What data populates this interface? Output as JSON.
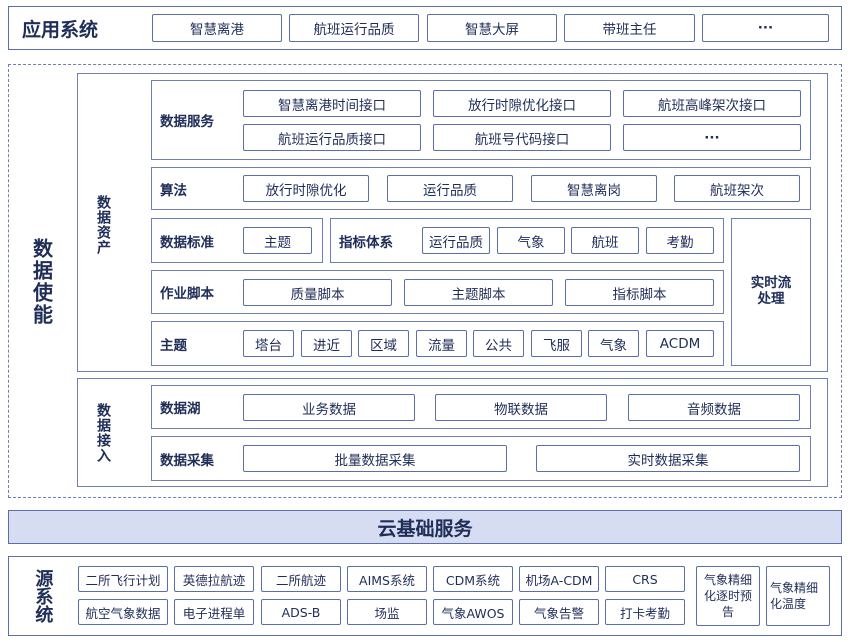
{
  "app_system": {
    "title": "应用系统",
    "items": [
      "智慧离港",
      "航班运行品质",
      "智慧大屏",
      "带班主任",
      "···"
    ]
  },
  "data_enable": {
    "title": "数据使能",
    "assets_title": "数据资产",
    "access_title": "数据接入",
    "data_service": {
      "label": "数据服务",
      "row1": [
        "智慧离港时间接口",
        "放行时隙优化接口",
        "航班高峰架次接口"
      ],
      "row2": [
        "航班运行品质接口",
        "航班号代码接口",
        "···"
      ]
    },
    "algorithm": {
      "label": "算法",
      "items": [
        "放行时隙优化",
        "运行品质",
        "智慧离岗",
        "航班架次"
      ]
    },
    "data_standard": {
      "label": "数据标准",
      "items": [
        "主题"
      ]
    },
    "indicator": {
      "label": "指标体系",
      "items": [
        "运行品质",
        "气象",
        "航班",
        "考勤"
      ]
    },
    "realtime": {
      "label": "实时流处理"
    },
    "job_script": {
      "label": "作业脚本",
      "items": [
        "质量脚本",
        "主题脚本",
        "指标脚本"
      ]
    },
    "topic": {
      "label": "主题",
      "items": [
        "塔台",
        "进近",
        "区域",
        "流量",
        "公共",
        "飞服",
        "气象",
        "ACDM"
      ]
    },
    "data_lake": {
      "label": "数据湖",
      "items": [
        "业务数据",
        "物联数据",
        "音频数据"
      ]
    },
    "collection": {
      "label": "数据采集",
      "items": [
        "批量数据采集",
        "实时数据采集"
      ]
    }
  },
  "cloud": {
    "title": "云基础服务"
  },
  "source": {
    "title": "源系统",
    "row1": [
      "二所飞行计划",
      "英德拉航迹",
      "二所航迹",
      "AIMS系统",
      "CDM系统",
      "机场A-CDM",
      "CRS"
    ],
    "row2": [
      "航空气象数据",
      "电子进程单",
      "ADS-B",
      "场监",
      "气象AWOS",
      "气象告警",
      "打卡考勤"
    ],
    "extra": [
      "气象精细化逐时预告",
      "气象精细化温度"
    ]
  }
}
